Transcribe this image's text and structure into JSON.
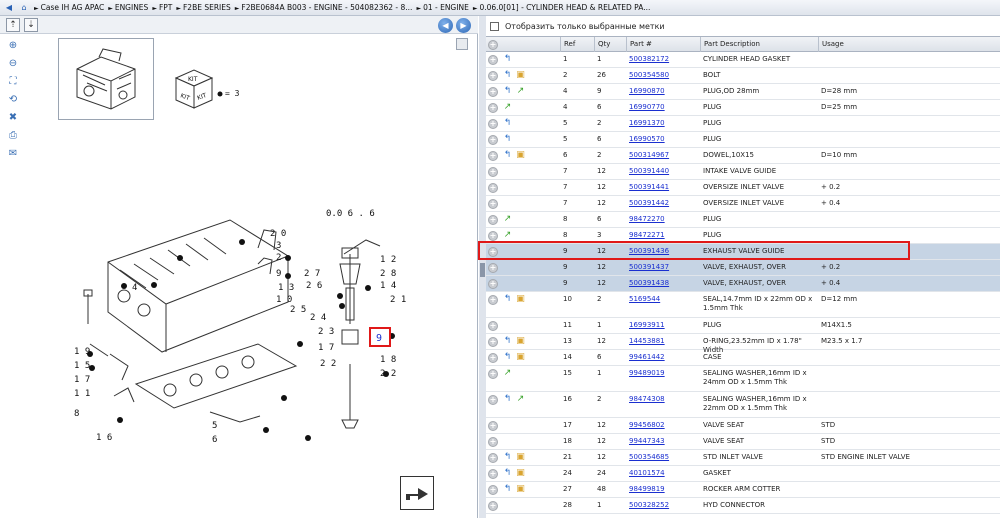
{
  "breadcrumb": {
    "items": [
      "Case IH AG APAC",
      "ENGINES",
      "FPT",
      "F2BE SERIES",
      "F2BE0684A B003 - ENGINE - 504082362 - 8...",
      "01 - ENGINE",
      "0.06.0[01] - CYLINDER HEAD & RELATED PA..."
    ]
  },
  "toolbar": {
    "nav_icons": [
      "back-icon",
      "home-icon"
    ],
    "kit_label": "KIT",
    "kit_qty": "= 3"
  },
  "diagram": {
    "callouts": [
      "0.06.6",
      "20",
      "3",
      "2",
      "9",
      "28",
      "12",
      "27",
      "26",
      "4",
      "13",
      "14",
      "10",
      "8",
      "25",
      "24",
      "21",
      "19",
      "15",
      "17",
      "16",
      "11",
      "5",
      "6",
      "7",
      "22",
      "18",
      "1",
      "9"
    ],
    "highlighted_callout": "9"
  },
  "filter": {
    "label": "Отобразить только выбранные метки"
  },
  "grid": {
    "columns": [
      "Ref",
      "Qty",
      "Part #",
      "Part Description",
      "Usage"
    ],
    "rows": [
      {
        "icons": [
          "blue"
        ],
        "ref": "1",
        "qty": "1",
        "part": "500382172",
        "desc": "CYLINDER HEAD GASKET",
        "usage": "",
        "h": 16
      },
      {
        "icons": [
          "blue",
          "box"
        ],
        "ref": "2",
        "qty": "26",
        "part": "500354580",
        "desc": "BOLT",
        "usage": "",
        "h": 16
      },
      {
        "icons": [
          "blue",
          "green"
        ],
        "ref": "4",
        "qty": "9",
        "part": "16990870",
        "desc": "PLUG,OD 28mm",
        "usage": "D=28 mm",
        "h": 16
      },
      {
        "icons": [
          "green"
        ],
        "ref": "4",
        "qty": "6",
        "part": "16990770",
        "desc": "PLUG",
        "usage": "D=25 mm",
        "h": 16
      },
      {
        "icons": [
          "blue"
        ],
        "ref": "5",
        "qty": "2",
        "part": "16991370",
        "desc": "PLUG",
        "usage": "",
        "h": 16
      },
      {
        "icons": [
          "blue"
        ],
        "ref": "5",
        "qty": "6",
        "part": "16990570",
        "desc": "PLUG",
        "usage": "",
        "h": 16
      },
      {
        "icons": [
          "blue",
          "box"
        ],
        "ref": "6",
        "qty": "2",
        "part": "500314967",
        "desc": "DOWEL,10X15",
        "usage": "D=10 mm",
        "h": 16
      },
      {
        "icons": [],
        "ref": "7",
        "qty": "12",
        "part": "500391440",
        "desc": "INTAKE VALVE GUIDE",
        "usage": "",
        "h": 16
      },
      {
        "icons": [],
        "ref": "7",
        "qty": "12",
        "part": "500391441",
        "desc": "OVERSIZE INLET VALVE",
        "usage": "+ 0.2",
        "h": 16
      },
      {
        "icons": [],
        "ref": "7",
        "qty": "12",
        "part": "500391442",
        "desc": "OVERSIZE INLET VALVE",
        "usage": "+ 0.4",
        "h": 16
      },
      {
        "icons": [
          "green"
        ],
        "ref": "8",
        "qty": "6",
        "part": "98472270",
        "desc": "PLUG",
        "usage": "",
        "h": 16
      },
      {
        "icons": [
          "green"
        ],
        "ref": "8",
        "qty": "3",
        "part": "98472271",
        "desc": "PLUG",
        "usage": "",
        "h": 16
      },
      {
        "icons": [],
        "ref": "9",
        "qty": "12",
        "part": "500391436",
        "desc": "EXHAUST VALVE GUIDE",
        "usage": "",
        "h": 16,
        "sel": true
      },
      {
        "icons": [],
        "ref": "9",
        "qty": "12",
        "part": "500391437",
        "desc": "VALVE, EXHAUST, OVER",
        "usage": "+ 0.2",
        "h": 16,
        "sel": true
      },
      {
        "icons": [],
        "ref": "9",
        "qty": "12",
        "part": "500391438",
        "desc": "VALVE, EXHAUST, OVER",
        "usage": "+ 0.4",
        "h": 16,
        "sel": true
      },
      {
        "icons": [
          "blue",
          "box"
        ],
        "ref": "10",
        "qty": "2",
        "part": "5169544",
        "desc": "SEAL,14.7mm ID x 22mm OD x 1.5mm Thk",
        "usage": "D=12 mm",
        "h": 26
      },
      {
        "icons": [],
        "ref": "11",
        "qty": "1",
        "part": "16993911",
        "desc": "PLUG",
        "usage": "M14X1.5",
        "h": 16
      },
      {
        "icons": [
          "blue",
          "box"
        ],
        "ref": "13",
        "qty": "12",
        "part": "14453881",
        "desc": "O-RING,23.52mm ID x 1.78\" Width",
        "usage": "M23.5 x 1.7",
        "h": 16
      },
      {
        "icons": [
          "blue",
          "box"
        ],
        "ref": "14",
        "qty": "6",
        "part": "99461442",
        "desc": "CASE",
        "usage": "",
        "h": 16
      },
      {
        "icons": [
          "green"
        ],
        "ref": "15",
        "qty": "1",
        "part": "99489019",
        "desc": "SEALING WASHER,16mm ID x 24mm OD x 1.5mm Thk",
        "usage": "",
        "h": 26
      },
      {
        "icons": [
          "blue",
          "green"
        ],
        "ref": "16",
        "qty": "2",
        "part": "98474308",
        "desc": "SEALING WASHER,16mm ID x 22mm OD x 1.5mm Thk",
        "usage": "",
        "h": 26
      },
      {
        "icons": [],
        "ref": "17",
        "qty": "12",
        "part": "99456802",
        "desc": "VALVE SEAT",
        "usage": "STD",
        "h": 16
      },
      {
        "icons": [],
        "ref": "18",
        "qty": "12",
        "part": "99447343",
        "desc": "VALVE SEAT",
        "usage": "STD",
        "h": 16
      },
      {
        "icons": [
          "blue",
          "box"
        ],
        "ref": "21",
        "qty": "12",
        "part": "500354685",
        "desc": "STD INLET VALVE",
        "usage": "STD ENGINE INLET VALVE",
        "h": 16
      },
      {
        "icons": [
          "blue",
          "box"
        ],
        "ref": "24",
        "qty": "24",
        "part": "40101574",
        "desc": "GASKET",
        "usage": "",
        "h": 16
      },
      {
        "icons": [
          "blue",
          "box"
        ],
        "ref": "27",
        "qty": "48",
        "part": "98499819",
        "desc": "ROCKER ARM COTTER",
        "usage": "",
        "h": 16
      },
      {
        "icons": [],
        "ref": "28",
        "qty": "1",
        "part": "500328252",
        "desc": "HYD CONNECTOR",
        "usage": "",
        "h": 16
      }
    ]
  },
  "colors": {
    "selected_row": "#c6d4e4",
    "highlight_border": "#e01919",
    "link": "#1a2fd0"
  }
}
